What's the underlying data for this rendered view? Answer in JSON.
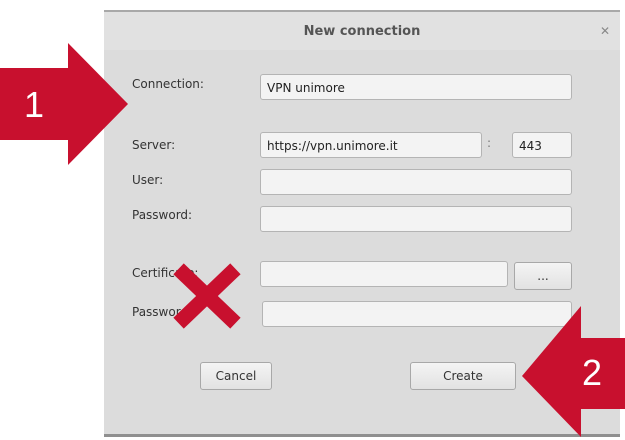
{
  "dialog": {
    "title": "New connection",
    "connection_label": "Connection:",
    "connection_value": "VPN unimore",
    "server_label": "Server:",
    "server_value": "https://vpn.unimore.it",
    "port_separator": ":",
    "port_value": "443",
    "user_label": "User:",
    "user_value": "",
    "password_label": "Password:",
    "password_value": "",
    "certificate_label": "Certificate:",
    "certificate_value": "",
    "browse_label": "...",
    "cert_password_label": "Password:",
    "cert_password_value": "",
    "cancel_label": "Cancel",
    "create_label": "Create"
  },
  "annotations": {
    "callout_1": "1",
    "callout_2": "2",
    "accent_color": "#c8102e"
  }
}
